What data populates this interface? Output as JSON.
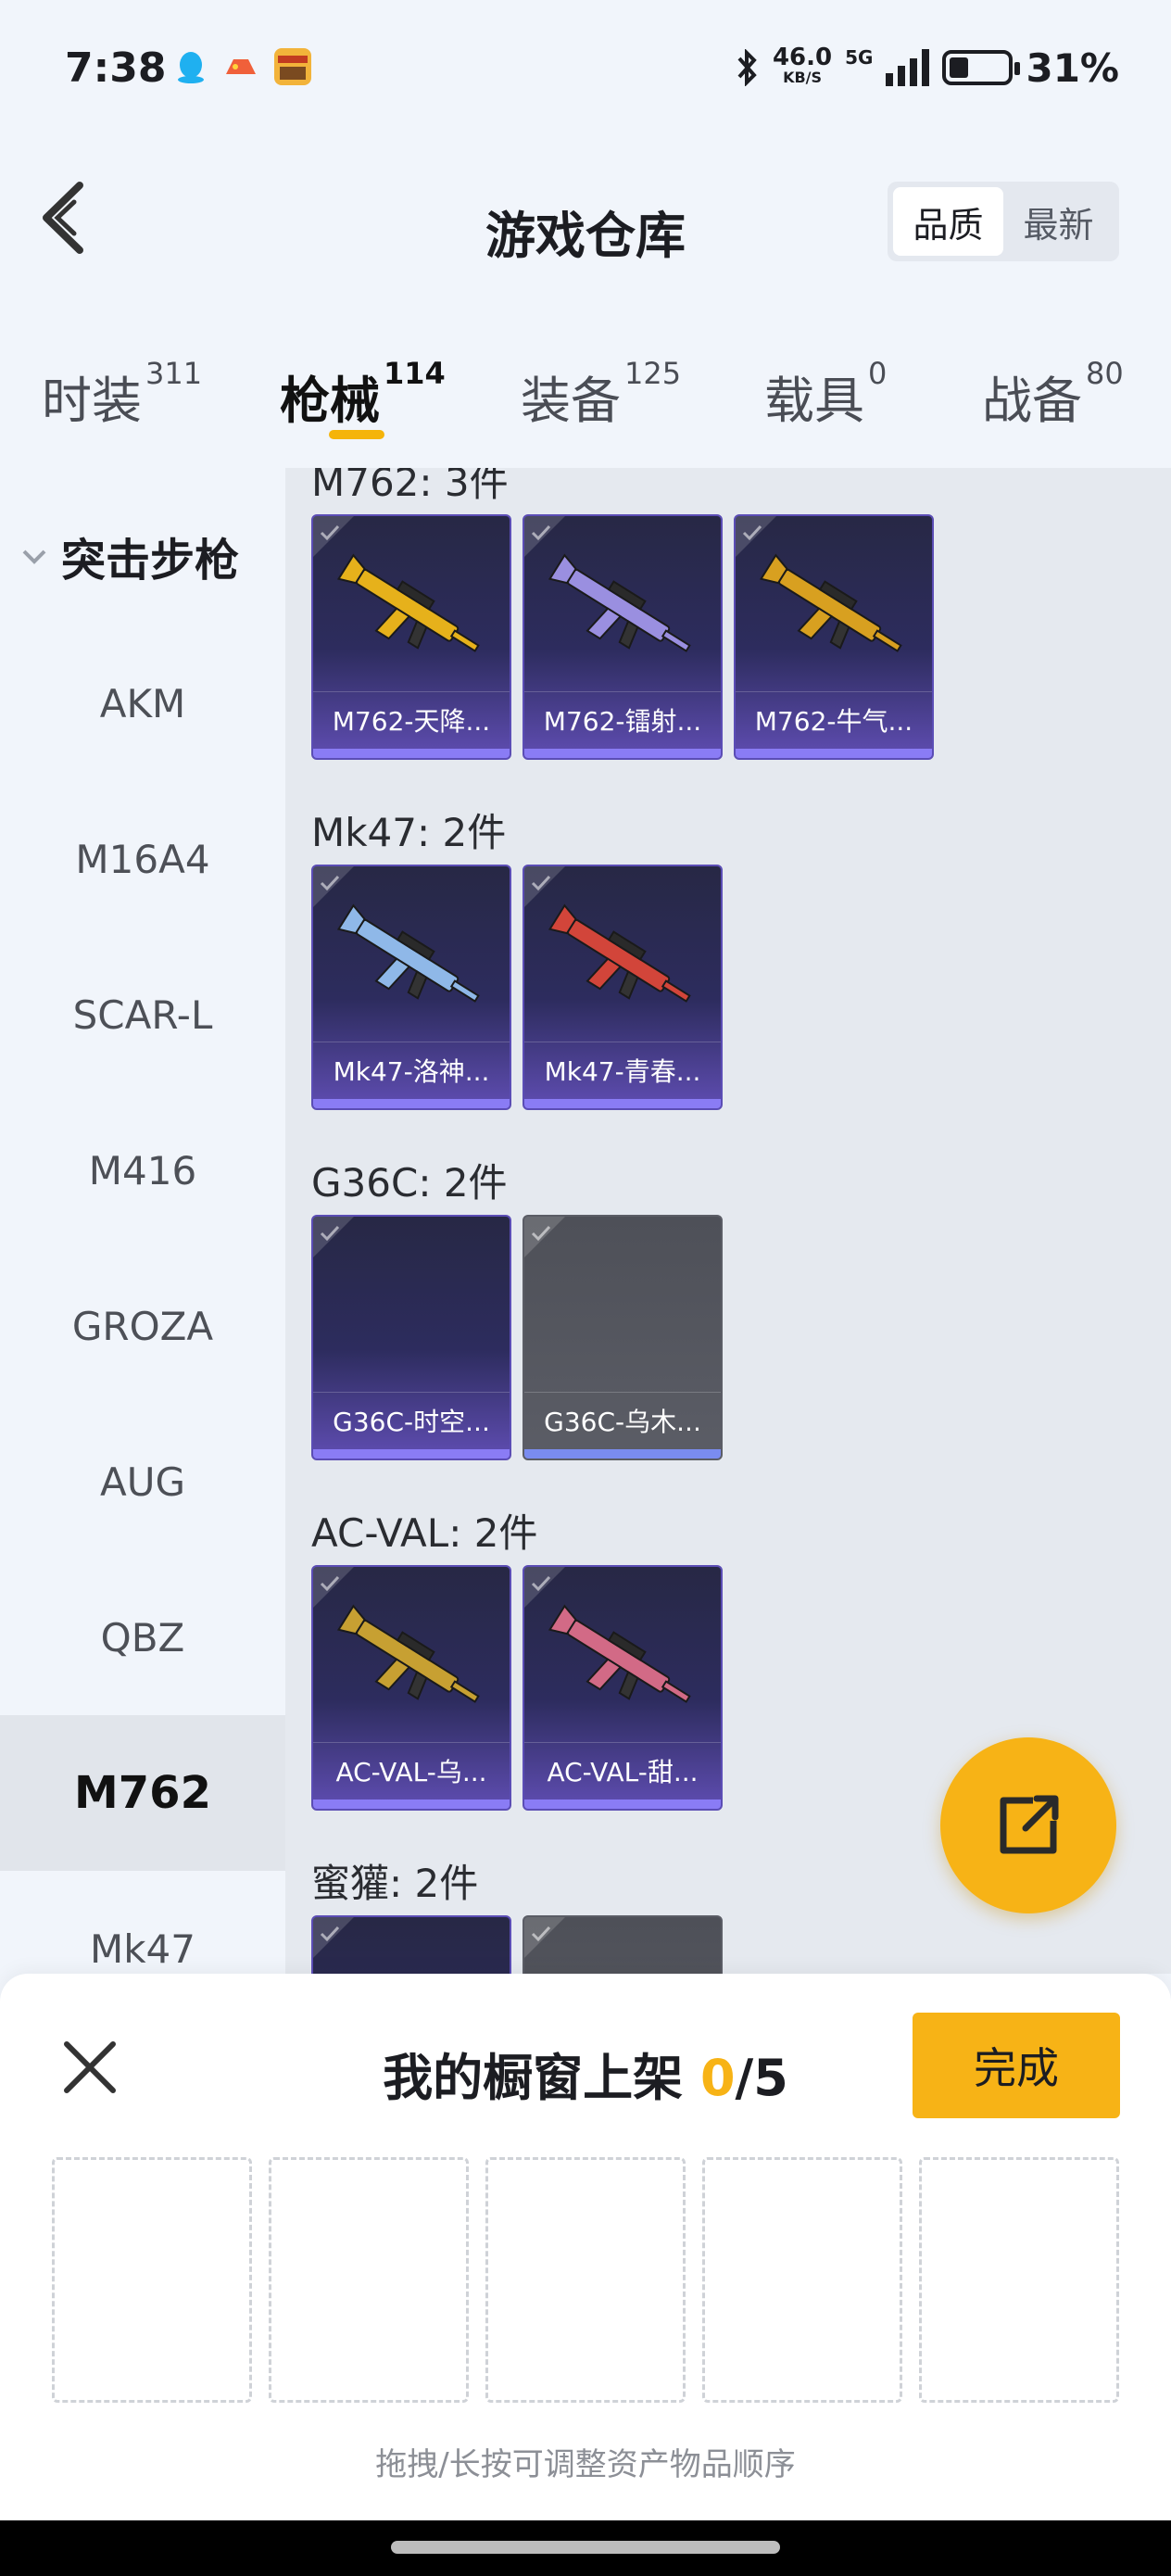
{
  "status_bar": {
    "time": "7:38",
    "speed_value": "46.0",
    "speed_unit": "KB/S",
    "network": "5G",
    "battery": "31%",
    "battery_level": 0.31
  },
  "header": {
    "title": "游戏仓库",
    "sort_options": [
      "品质",
      "最新"
    ],
    "sort_active": "品质"
  },
  "tabs": [
    {
      "label": "时装",
      "count": "311"
    },
    {
      "label": "枪械",
      "count": "114"
    },
    {
      "label": "装备",
      "count": "125"
    },
    {
      "label": "载具",
      "count": "0"
    },
    {
      "label": "战备",
      "count": "80"
    }
  ],
  "active_tab": "枪械",
  "sidebar": {
    "group_label": "突击步枪",
    "items": [
      "AKM",
      "M16A4",
      "SCAR-L",
      "M416",
      "GROZA",
      "AUG",
      "QBZ",
      "M762",
      "Mk47"
    ],
    "active_item": "M762"
  },
  "sections": [
    {
      "title": "M762: 3件",
      "items": [
        {
          "label": "M762-天降...",
          "style": "purple",
          "gun_color": "#e6b11b"
        },
        {
          "label": "M762-镭射...",
          "style": "purple",
          "gun_color": "#9a8fe0"
        },
        {
          "label": "M762-牛气...",
          "style": "purple",
          "gun_color": "#d8a020"
        }
      ]
    },
    {
      "title": "Mk47: 2件",
      "items": [
        {
          "label": "Mk47-洛神...",
          "style": "purple",
          "gun_color": "#8fb8e8"
        },
        {
          "label": "Mk47-青春...",
          "style": "purple",
          "gun_color": "#d2453a"
        }
      ]
    },
    {
      "title": "G36C: 2件",
      "items": [
        {
          "label": "G36C-时空...",
          "style": "purple",
          "gun_color": ""
        },
        {
          "label": "G36C-乌木...",
          "style": "grey",
          "gun_color": ""
        }
      ]
    },
    {
      "title": "AC-VAL: 2件",
      "items": [
        {
          "label": "AC-VAL-乌...",
          "style": "purple",
          "gun_color": "#c7a032"
        },
        {
          "label": "AC-VAL-甜...",
          "style": "purple",
          "gun_color": "#d26a86"
        }
      ]
    },
    {
      "title": "蜜獾: 2件",
      "items": [
        {
          "label": "",
          "style": "purple",
          "gun_color": ""
        },
        {
          "label": "",
          "style": "grey",
          "gun_color": ""
        }
      ]
    }
  ],
  "showcase": {
    "title_prefix": "我的橱窗上架 ",
    "current": "0",
    "sep_total": "/5",
    "done_label": "完成",
    "hint": "拖拽/长按可调整资产物品顺序",
    "slot_count": 5
  },
  "colors": {
    "accent": "#f7b316",
    "card_purple": "#2d2c5e",
    "card_grey": "#5b5d66"
  }
}
